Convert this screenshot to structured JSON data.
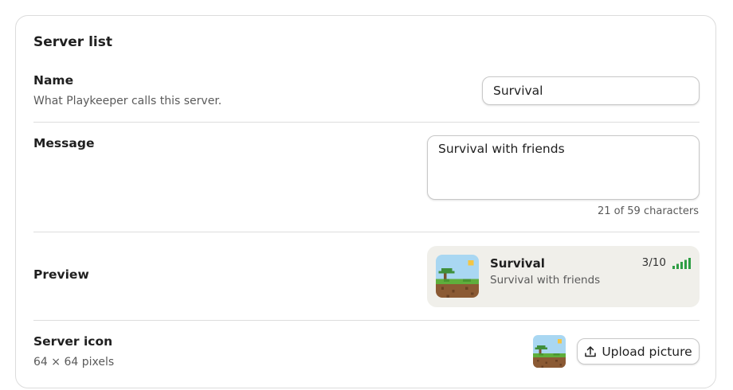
{
  "card": {
    "title": "Server list"
  },
  "name_field": {
    "label": "Name",
    "description": "What Playkeeper calls this server.",
    "value": "Survival"
  },
  "message_field": {
    "label": "Message",
    "value": "Survival with friends",
    "char_count_text": "21 of 59 characters"
  },
  "preview": {
    "label": "Preview",
    "server_name": "Survival",
    "motd": "Survival with friends",
    "players": "3/10",
    "signal_icon": "signal-bars-icon",
    "signal_color": "#2e9e44"
  },
  "server_icon": {
    "label": "Server icon",
    "description": "64 × 64 pixels",
    "upload_label": "Upload picture",
    "upload_icon": "upload-icon"
  },
  "colors": {
    "preview_bg": "#f0efea",
    "border": "#dcdcdc"
  }
}
